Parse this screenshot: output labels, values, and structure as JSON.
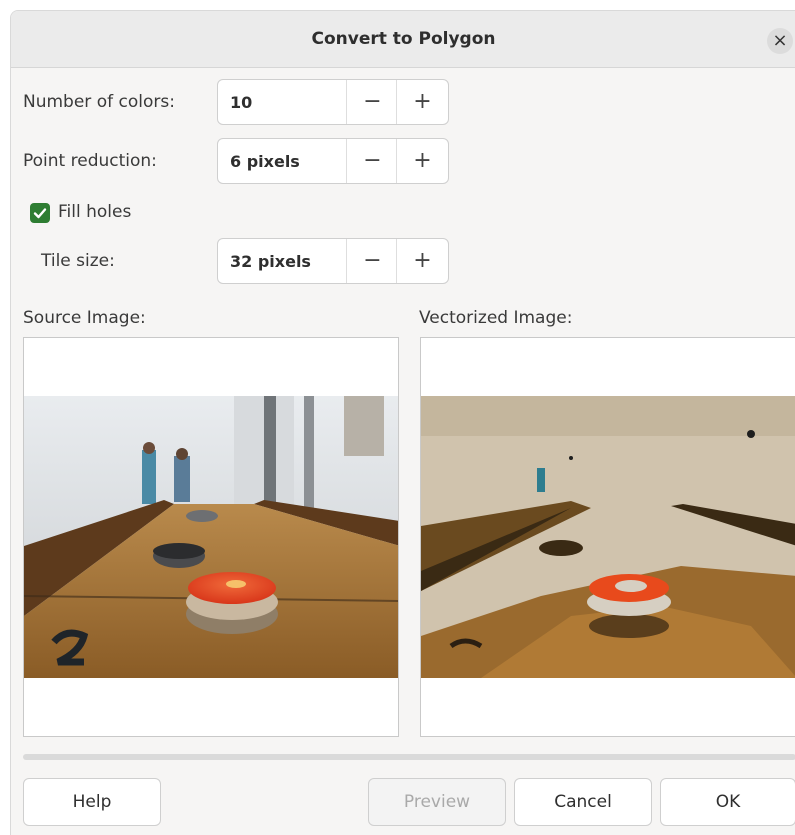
{
  "dialog": {
    "title": "Convert to Polygon",
    "close_symbol": "×"
  },
  "fields": {
    "colors": {
      "label": "Number of colors:",
      "value": "10",
      "minus": "−",
      "plus": "+"
    },
    "point_reduction": {
      "label": "Point reduction:",
      "value": "6 pixels",
      "minus": "−",
      "plus": "+"
    },
    "fill_holes": {
      "label": "Fill holes",
      "checked": true
    },
    "tile_size": {
      "label": "Tile size:",
      "value": "32 pixels",
      "minus": "−",
      "plus": "+"
    }
  },
  "previews": {
    "source_label": "Source Image:",
    "vectorized_label": "Vectorized Image:"
  },
  "buttons": {
    "help": "Help",
    "preview": "Preview",
    "cancel": "Cancel",
    "ok": "OK"
  },
  "colors": {
    "checkbox_accent": "#2e7d32",
    "puck_orange": "#e8421c",
    "board_wood": "#9a6a2e"
  },
  "icons": {
    "close": "close-icon",
    "check": "checkmark-icon"
  }
}
